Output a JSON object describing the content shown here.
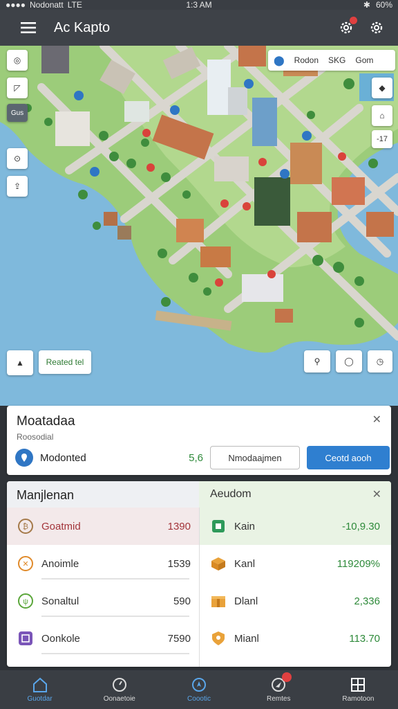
{
  "status_bar": {
    "carrier": "Nodonatt",
    "network": "LTE",
    "time": "1:3 AM",
    "battery": "60%"
  },
  "app_bar": {
    "title": "Ac Kapto",
    "menu_icon": "hamburger-menu-icon",
    "actions": [
      "settings-gear-icon",
      "gear-icon"
    ]
  },
  "map": {
    "left_controls": [
      "gps-icon",
      "compass-icon",
      "layers-label"
    ],
    "layers_label": "Gus",
    "search_chip": "Rodon",
    "filter_chip": "SKG",
    "extra_chip": "Gom",
    "zoom_badge": "-17",
    "place_chip": "Reated tel",
    "lower_right_controls": [
      "locate-icon",
      "record-icon",
      "clock-icon"
    ]
  },
  "info_card": {
    "title": "Moatadaa",
    "subtitle": "Roosodial",
    "location_label": "Modonted",
    "location_value": "5,6",
    "secondary_button": "Nmodaajmen",
    "primary_button": "Ceotd aooh"
  },
  "stats_card": {
    "left_header": "Manjlenan",
    "right_header": "Aeudom",
    "left_rows": [
      {
        "name": "Goatmid",
        "value": "1390",
        "progress": 0.0
      },
      {
        "name": "Anoimle",
        "value": "1539",
        "progress": 0.0
      },
      {
        "name": "Sonaltul",
        "value": "590",
        "progress": 0.0
      },
      {
        "name": "Oonkole",
        "value": "7590",
        "progress": 0.0
      }
    ],
    "right_rows": [
      {
        "name": "Kain",
        "value": "-10,9.30"
      },
      {
        "name": "Kanl",
        "value": "119209%"
      },
      {
        "name": "Dlanl",
        "value": "2,336"
      },
      {
        "name": "Mianl",
        "value": "113.70"
      }
    ]
  },
  "bottom_nav": {
    "items": [
      {
        "label": "Guotdar",
        "icon": "home-icon",
        "active": true
      },
      {
        "label": "Oonaetoie",
        "icon": "timer-icon",
        "active": false
      },
      {
        "label": "Coootic",
        "icon": "location-circle-icon",
        "active": true
      },
      {
        "label": "Remtes",
        "icon": "navigation-icon",
        "active": false
      },
      {
        "label": "Ramotoon",
        "icon": "grid-icon",
        "active": false
      }
    ]
  },
  "colors": {
    "accent_blue": "#2f7fd0",
    "positive_green": "#2e8a3a",
    "app_bar": "#3e4248"
  }
}
